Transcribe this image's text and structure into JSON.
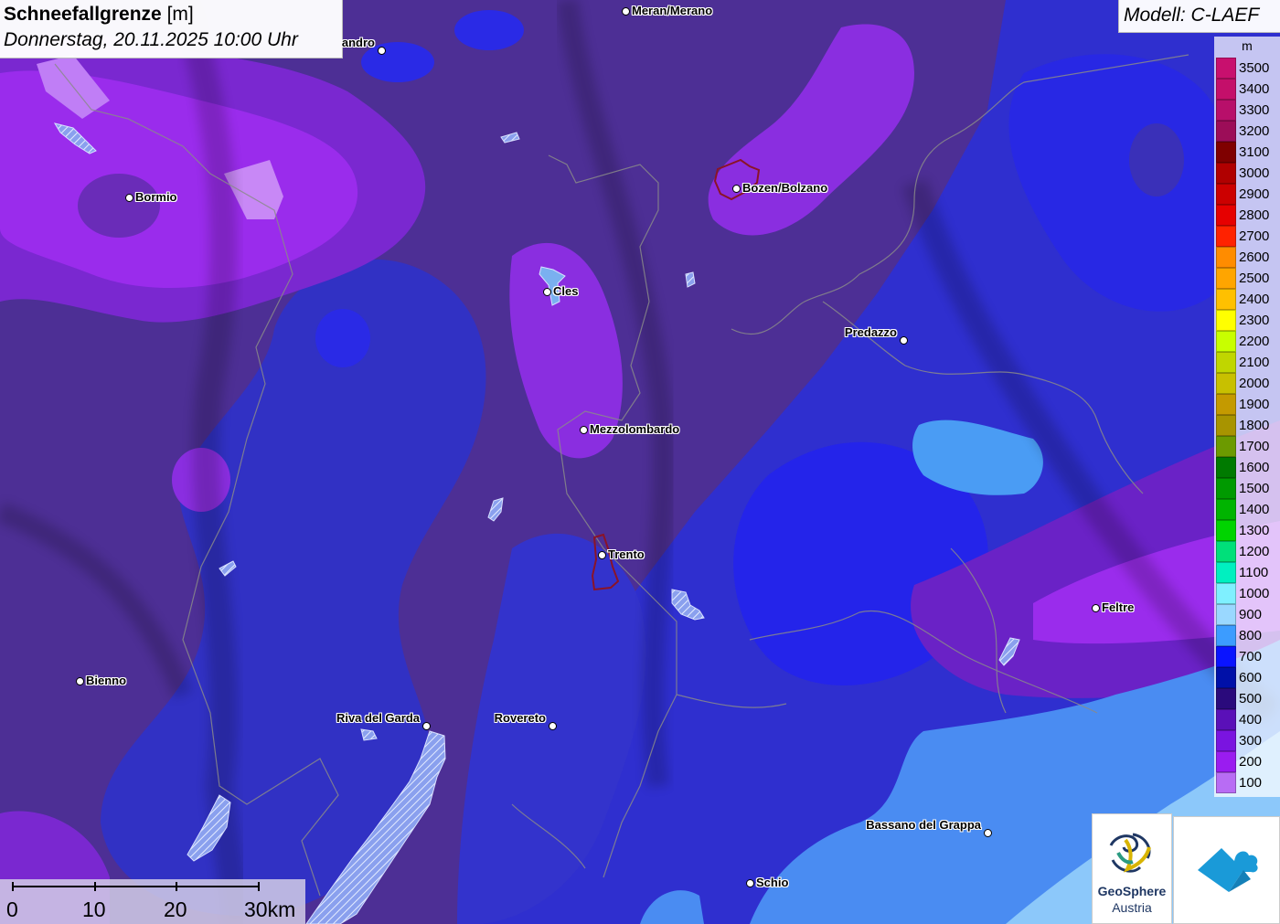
{
  "title": {
    "variable": "Schneefallgrenze",
    "unit": "[m]",
    "datetime": "Donnerstag, 20.11.2025 10:00 Uhr"
  },
  "model_label": "Modell: C-LAEF",
  "legend": {
    "unit": "m",
    "entries": [
      {
        "label": "3500",
        "color": "#c8106e"
      },
      {
        "label": "3400",
        "color": "#c40f6a"
      },
      {
        "label": "3300",
        "color": "#b80f6a"
      },
      {
        "label": "3200",
        "color": "#9c0d58"
      },
      {
        "label": "3100",
        "color": "#7f0000"
      },
      {
        "label": "3000",
        "color": "#b00000"
      },
      {
        "label": "2900",
        "color": "#cc0000"
      },
      {
        "label": "2800",
        "color": "#e60000"
      },
      {
        "label": "2700",
        "color": "#ff2200"
      },
      {
        "label": "2600",
        "color": "#ff8c00"
      },
      {
        "label": "2500",
        "color": "#ffa500"
      },
      {
        "label": "2400",
        "color": "#ffc000"
      },
      {
        "label": "2300",
        "color": "#ffff00"
      },
      {
        "label": "2200",
        "color": "#c8ff00"
      },
      {
        "label": "2100",
        "color": "#c0d600"
      },
      {
        "label": "2000",
        "color": "#c8c000"
      },
      {
        "label": "1900",
        "color": "#c49a00"
      },
      {
        "label": "1800",
        "color": "#a89400"
      },
      {
        "label": "1700",
        "color": "#6c9a00"
      },
      {
        "label": "1600",
        "color": "#007a00"
      },
      {
        "label": "1500",
        "color": "#009a00"
      },
      {
        "label": "1400",
        "color": "#00b400"
      },
      {
        "label": "1300",
        "color": "#00d400"
      },
      {
        "label": "1200",
        "color": "#00e07a"
      },
      {
        "label": "1100",
        "color": "#00f0c0"
      },
      {
        "label": "1000",
        "color": "#7ff0ff"
      },
      {
        "label": "900",
        "color": "#9ad8ff"
      },
      {
        "label": "800",
        "color": "#3c9cff"
      },
      {
        "label": "700",
        "color": "#0a14ff"
      },
      {
        "label": "600",
        "color": "#0010a8"
      },
      {
        "label": "500",
        "color": "#2a0a7c"
      },
      {
        "label": "400",
        "color": "#5a10b8"
      },
      {
        "label": "300",
        "color": "#7a14e0"
      },
      {
        "label": "200",
        "color": "#9a1cf0"
      },
      {
        "label": "100",
        "color": "#b86cf4"
      }
    ]
  },
  "cities": [
    {
      "name": "Meran/Merano",
      "side": "right"
    },
    {
      "name": "andro",
      "side": "left"
    },
    {
      "name": "Bormio",
      "side": "right"
    },
    {
      "name": "Bozen/Bolzano",
      "side": "right"
    },
    {
      "name": "Cles",
      "side": "right"
    },
    {
      "name": "Predazzo",
      "side": "left"
    },
    {
      "name": "Mezzolombardo",
      "side": "right"
    },
    {
      "name": "Trento",
      "side": "right"
    },
    {
      "name": "Feltre",
      "side": "right"
    },
    {
      "name": "Bienno",
      "side": "right"
    },
    {
      "name": "Riva del Garda",
      "side": "left"
    },
    {
      "name": "Rovereto",
      "side": "left"
    },
    {
      "name": "Bassano del Grappa",
      "side": "left"
    },
    {
      "name": "Schio",
      "side": "right"
    }
  ],
  "scale_bar": {
    "ticks": [
      "0",
      "10",
      "20",
      "30km"
    ]
  },
  "logos": {
    "geosphere_name": "GeoSphere",
    "geosphere_sub": "Austria"
  }
}
